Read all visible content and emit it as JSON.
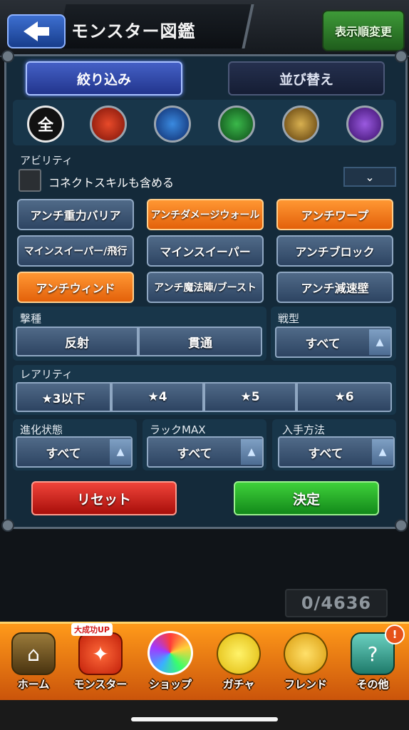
{
  "header": {
    "title": "モンスター図鑑",
    "sort_order_label": "表示順変更"
  },
  "tabs": {
    "filter_label": "絞り込み",
    "sort_label": "並び替え"
  },
  "attributes": [
    {
      "name": "all",
      "label": "全",
      "color": "#111111"
    },
    {
      "name": "fire",
      "label": "",
      "color": "#b22a1a"
    },
    {
      "name": "water",
      "label": "",
      "color": "#1f4fb0"
    },
    {
      "name": "wood",
      "label": "",
      "color": "#1f7a2a"
    },
    {
      "name": "light",
      "label": "",
      "color": "#8a6a1a"
    },
    {
      "name": "dark",
      "label": "",
      "color": "#5a2a9a"
    }
  ],
  "ability": {
    "section_label": "アビリティ",
    "connect_skill_label": "コネクトスキルも含める",
    "dropdown_icon": "⌄",
    "buttons": [
      {
        "label": "アンチ重力バリア",
        "active": false
      },
      {
        "label": "アンチダメージウォール",
        "active": true
      },
      {
        "label": "アンチワープ",
        "active": true
      },
      {
        "label": "マインスイーパー/飛行",
        "active": false
      },
      {
        "label": "マインスイーパー",
        "active": false
      },
      {
        "label": "アンチブロック",
        "active": false
      },
      {
        "label": "アンチウィンド",
        "active": true
      },
      {
        "label": "アンチ魔法陣/ブースト",
        "active": false
      },
      {
        "label": "アンチ減速壁",
        "active": false
      }
    ]
  },
  "strike": {
    "section_label": "撃種",
    "options": [
      "反射",
      "貫通"
    ]
  },
  "battle_type": {
    "section_label": "戦型",
    "value": "すべて"
  },
  "rarity": {
    "section_label": "レアリティ",
    "options": [
      "★3以下",
      "★4",
      "★5",
      "★6"
    ]
  },
  "evolution": {
    "section_label": "進化状態",
    "value": "すべて"
  },
  "luck_max": {
    "section_label": "ラックMAX",
    "value": "すべて"
  },
  "acquisition": {
    "section_label": "入手方法",
    "value": "すべて"
  },
  "actions": {
    "reset_label": "リセット",
    "decide_label": "決定"
  },
  "count_text": "0/4636",
  "nav": {
    "bonus_badge": "大成功UP",
    "notify_badge": "!",
    "items": [
      {
        "label": "ホーム",
        "icon": "home-icon"
      },
      {
        "label": "モンスター",
        "icon": "monster-icon"
      },
      {
        "label": "ショップ",
        "icon": "orb-icon"
      },
      {
        "label": "ガチャ",
        "icon": "egg-icon"
      },
      {
        "label": "フレンド",
        "icon": "friends-icon"
      },
      {
        "label": "その他",
        "icon": "question-icon"
      }
    ]
  }
}
